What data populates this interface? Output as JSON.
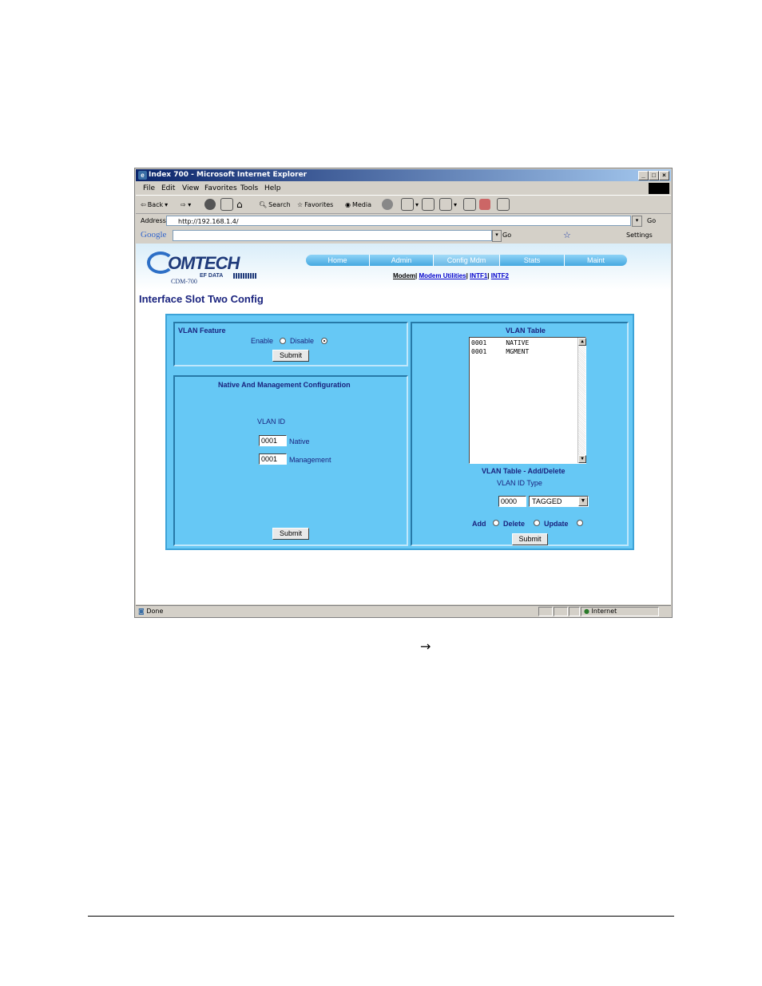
{
  "window": {
    "title": "Index 700 - Microsoft Internet Explorer",
    "controls": {
      "minimize": "_",
      "maximize": "□",
      "close": "×"
    }
  },
  "menu": [
    "File",
    "Edit",
    "View",
    "Favorites",
    "Tools",
    "Help"
  ],
  "toolbar": {
    "back": "Back",
    "search": "Search",
    "favorites": "Favorites",
    "media": "Media"
  },
  "address": {
    "label": "Address",
    "url": "http://192.168.1.4/",
    "go": "Go"
  },
  "google": {
    "logo": "Google",
    "go": "Go",
    "settings": "Settings"
  },
  "site": {
    "logo_main": "OMTECH",
    "logo_sub": "EF DATA",
    "model": "CDM-700",
    "nav": [
      "Home",
      "Admin",
      "Config Mdm",
      "Stats",
      "Maint"
    ],
    "nav_active": "Config Mdm",
    "subnav": [
      "Modem",
      "Modem Utilities",
      "INTF1",
      "INTF2"
    ],
    "page_title": "Interface Slot Two Config"
  },
  "vlan_feature": {
    "title": "VLAN Feature",
    "enable_label": "Enable",
    "disable_label": "Disable",
    "selected": "Disable",
    "submit": "Submit"
  },
  "native_mgmt": {
    "title": "Native And Management Configuration",
    "vlan_id_label": "VLAN ID",
    "native_value": "0001",
    "native_label": "Native",
    "mgmt_value": "0001",
    "mgmt_label": "Management",
    "submit": "Submit"
  },
  "vlan_table": {
    "title": "VLAN Table",
    "rows": [
      {
        "id": "0001",
        "type": "NATIVE"
      },
      {
        "id": "0001",
        "type": "MGMENT"
      }
    ],
    "add_delete_title": "VLAN Table - Add/Delete",
    "id_type_label": "VLAN ID Type",
    "id_value": "0000",
    "type_value": "TAGGED",
    "add_label": "Add",
    "delete_label": "Delete",
    "update_label": "Update",
    "submit": "Submit"
  },
  "status": {
    "left": "Done",
    "zone": "Internet"
  },
  "page_arrow": "→"
}
